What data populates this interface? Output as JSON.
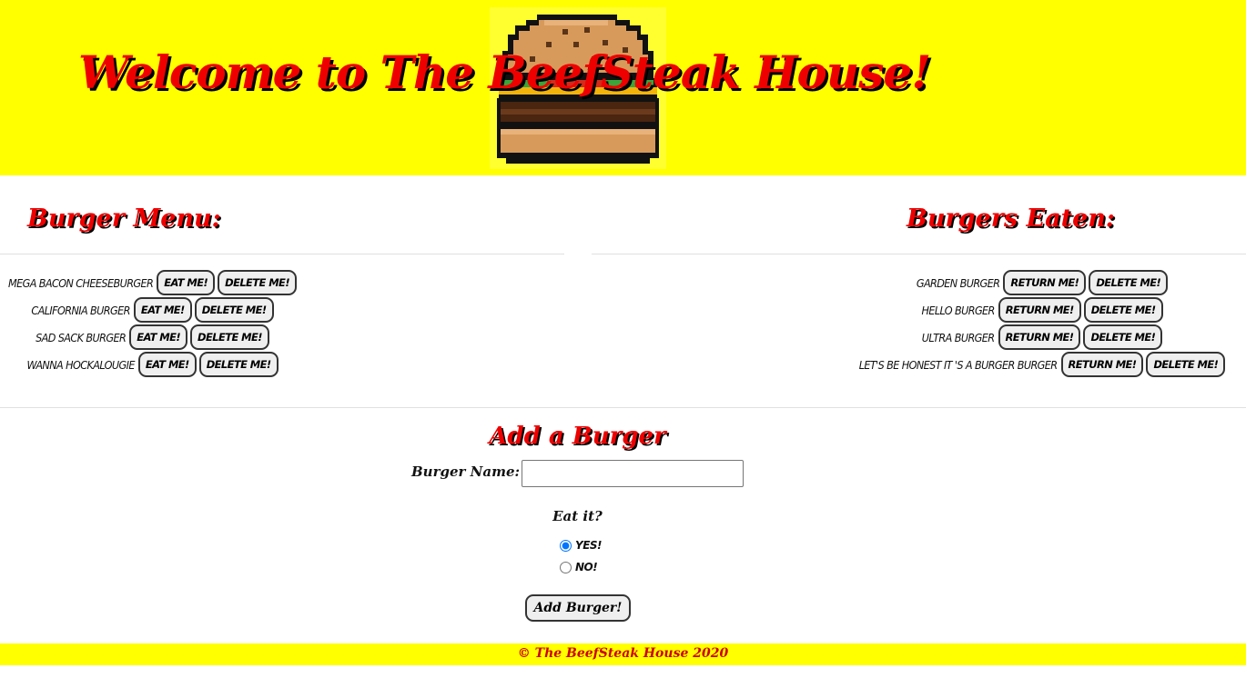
{
  "header": {
    "title": "Welcome to The BeefSteak House!",
    "logo_icon": "pixel-burger-icon"
  },
  "menu": {
    "heading": "Burger Menu:",
    "items": [
      {
        "name": "Mega Bacon Cheeseburger",
        "eat_label": "Eat Me!",
        "delete_label": "Delete Me!"
      },
      {
        "name": "California Burger",
        "eat_label": "Eat Me!",
        "delete_label": "Delete Me!"
      },
      {
        "name": "Sad Sack Burger",
        "eat_label": "Eat Me!",
        "delete_label": "Delete Me!"
      },
      {
        "name": "Wanna Hockalougie",
        "eat_label": "Eat Me!",
        "delete_label": "Delete Me!"
      }
    ]
  },
  "eaten": {
    "heading": "Burgers Eaten:",
    "items": [
      {
        "name": "Garden Burger",
        "return_label": "Return Me!",
        "delete_label": "Delete Me!"
      },
      {
        "name": "Hello Burger",
        "return_label": "Return Me!",
        "delete_label": "Delete Me!"
      },
      {
        "name": "Ultra Burger",
        "return_label": "Return Me!",
        "delete_label": "Delete Me!"
      },
      {
        "name": "Let's be honest it 's a burger burger",
        "return_label": "Return Me!",
        "delete_label": "Delete Me!"
      }
    ]
  },
  "add_form": {
    "heading": "Add a Burger",
    "name_label": "Burger Name:",
    "name_value": "",
    "eat_label": "Eat it?",
    "yes_label": "Yes!",
    "no_label": "No!",
    "selected": "yes",
    "submit_label": "Add Burger!"
  },
  "footer": {
    "text": "© The BeefSteak House 2020"
  },
  "colors": {
    "header_bg": "#ffff00",
    "heading_red": "#ee0000",
    "footer_text": "#cc0000"
  }
}
